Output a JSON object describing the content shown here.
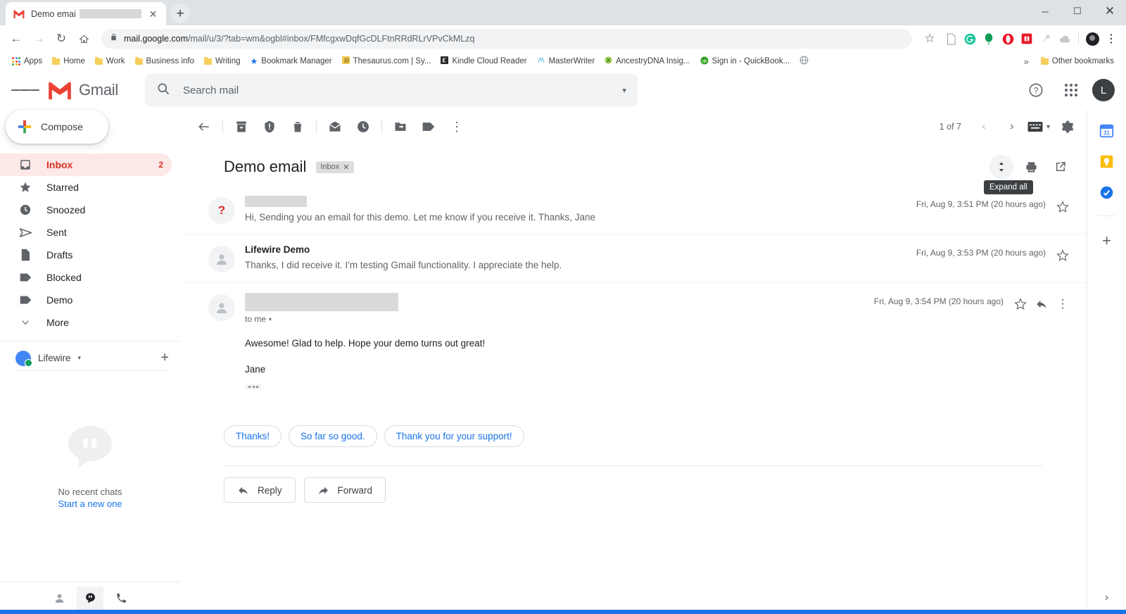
{
  "browser": {
    "tab": {
      "title": "Demo email",
      "favicon": "gmail-icon",
      "close": "✕"
    },
    "new_tab_label": "+",
    "window_controls": {
      "minimize": "─",
      "maximize": "☐",
      "close": "✕"
    },
    "nav": {
      "back": "←",
      "forward": "→",
      "reload": "↻",
      "home": "⌂"
    },
    "omnibox": {
      "lock": "lock-icon",
      "url_domain": "mail.google.com",
      "url_path": "/mail/u/3/?tab=wm&ogbl#inbox/FMfcgxwDqfGcDLFtnRRdRLrVPvCkMLzq",
      "star": "☆"
    },
    "extensions": [
      "document-icon",
      "grammarly-icon",
      "balloon-icon",
      "opera-icon",
      "red-square-icon",
      "wrench-icon",
      "cloud-icon",
      "profile-avatar-icon"
    ],
    "menu": "⋮",
    "bookmarks": [
      {
        "label": "Apps",
        "icon": "apps-grid-icon"
      },
      {
        "label": "Home",
        "icon": "folder-icon"
      },
      {
        "label": "Work",
        "icon": "folder-icon"
      },
      {
        "label": "Business info",
        "icon": "folder-icon"
      },
      {
        "label": "Writing",
        "icon": "folder-icon"
      },
      {
        "label": "Bookmark Manager",
        "icon": "star-icon"
      },
      {
        "label": "Thesaurus.com | Sy...",
        "icon": "thesaurus-icon"
      },
      {
        "label": "Kindle Cloud Reader",
        "icon": "kindle-icon"
      },
      {
        "label": "MasterWriter",
        "icon": "masterwriter-icon"
      },
      {
        "label": "AncestryDNA Insig...",
        "icon": "ancestry-icon"
      },
      {
        "label": "Sign in - QuickBook...",
        "icon": "quickbooks-icon"
      },
      {
        "label": "",
        "icon": "globe-icon"
      }
    ],
    "bookmarks_overflow": "»",
    "other_bookmarks": "Other bookmarks"
  },
  "gmail": {
    "hamburger": "main-menu",
    "brand": "Gmail",
    "search": {
      "placeholder": "Search mail",
      "icon": "search-icon",
      "options_caret": "▾"
    },
    "help_icon": "help-icon",
    "apps_icon": "google-apps-icon",
    "account_initial": "L",
    "compose": {
      "label": "Compose",
      "icon": "compose-plus-icon"
    },
    "nav_items": [
      {
        "label": "Inbox",
        "icon": "inbox-icon",
        "count": "2",
        "active": true
      },
      {
        "label": "Starred",
        "icon": "star-icon",
        "count": "",
        "active": false
      },
      {
        "label": "Snoozed",
        "icon": "clock-icon",
        "count": "",
        "active": false
      },
      {
        "label": "Sent",
        "icon": "send-icon",
        "count": "",
        "active": false
      },
      {
        "label": "Drafts",
        "icon": "draft-icon",
        "count": "",
        "active": false
      },
      {
        "label": "Blocked",
        "icon": "label-icon",
        "count": "",
        "active": false
      },
      {
        "label": "Demo",
        "icon": "label-icon",
        "count": "",
        "active": false
      },
      {
        "label": "More",
        "icon": "chevron-down-icon",
        "count": "",
        "active": false
      }
    ],
    "hangouts": {
      "user": "Lifewire",
      "caret": "▾",
      "add": "+",
      "empty_title": "No recent chats",
      "empty_link": "Start a new one",
      "footer_icons": [
        "contacts-icon",
        "hangouts-icon",
        "phone-icon"
      ]
    },
    "toolbar": {
      "back": "back-to-inbox",
      "archive": "archive-icon",
      "spam": "report-spam-icon",
      "delete": "delete-icon",
      "mark_unread": "mark-as-unread-icon",
      "snooze": "snooze-icon",
      "move_to": "move-to-icon",
      "labels": "labels-icon",
      "more": "⋮",
      "pager": "1 of 7",
      "prev": "‹",
      "next": "›",
      "input_tools": "keyboard-icon",
      "input_tools_caret": "▾",
      "settings": "gear-icon"
    },
    "thread": {
      "subject": "Demo email",
      "label": "Inbox",
      "label_remove": "✕",
      "expand_all_tooltip": "Expand all",
      "expand_all_icon": "expand-all-icon",
      "print_icon": "print-icon",
      "popout_icon": "open-in-new-window-icon",
      "messages": [
        {
          "sender": "",
          "sender_redacted": true,
          "avatar": "?",
          "snippet": "Hi, Sending you an email for this demo. Let me know if you receive it. Thanks, Jane",
          "timestamp": "Fri, Aug 9, 3:51 PM (20 hours ago)",
          "expanded": false
        },
        {
          "sender": "Lifewire Demo",
          "sender_redacted": false,
          "avatar": "person",
          "snippet": "Thanks, I did receive it. I'm testing Gmail functionality. I appreciate the help.",
          "timestamp": "Fri, Aug 9, 3:53 PM (20 hours ago)",
          "expanded": false
        },
        {
          "sender": "",
          "sender_redacted": true,
          "avatar": "person",
          "to_line": "to me",
          "to_caret": "▾",
          "body_line_1": "Awesome! Glad to help. Hope your demo turns out great!",
          "body_line_2": "Jane",
          "trimmed_content": "show-trimmed-content",
          "timestamp": "Fri, Aug 9, 3:54 PM (20 hours ago)",
          "expanded": true
        }
      ],
      "smart_replies": [
        "Thanks!",
        "So far so good.",
        "Thank you for your support!"
      ],
      "reply_button": "Reply",
      "forward_button": "Forward"
    },
    "rail": {
      "items": [
        "calendar-icon",
        "keep-icon",
        "tasks-icon"
      ],
      "calendar_day": "31",
      "add_label": "+",
      "expand": "›"
    }
  },
  "colors": {
    "accent_red": "#d93025",
    "link_blue": "#1a73e8",
    "chrome_bg": "#dee1e6",
    "inbox_active_bg": "#fce8e6",
    "tooltip_bg": "#3c4043"
  }
}
